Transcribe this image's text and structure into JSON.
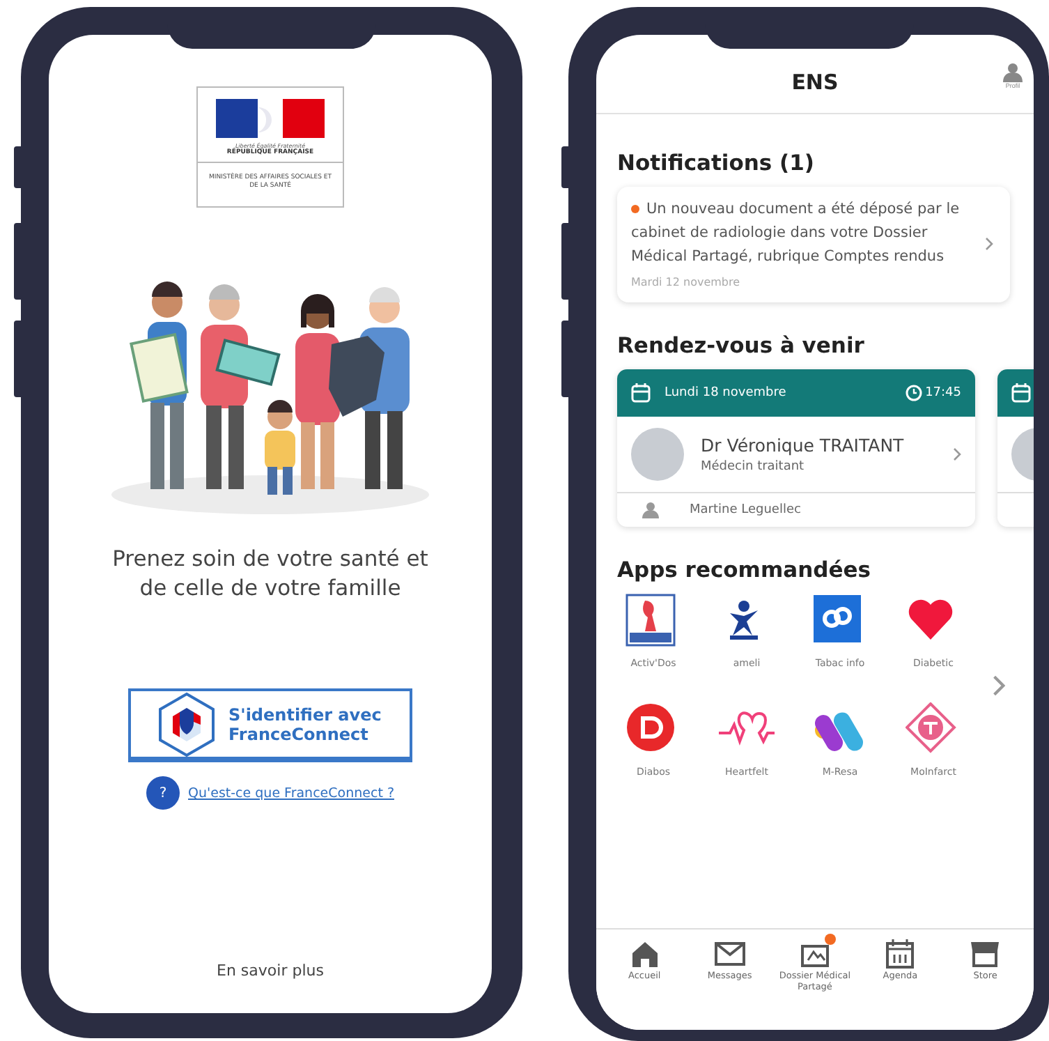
{
  "left_screen": {
    "logo": {
      "motto": "Liberté Égalité Fraternité",
      "republic": "RÉPUBLIQUE FRANÇAISE",
      "ministry": "MINISTÈRE DES AFFAIRES SOCIALES ET DE LA SANTÉ"
    },
    "tagline": "Prenez soin de votre santé et de celle de votre famille",
    "login_button": {
      "line1": "S'identifier avec",
      "line2": "FranceConnect"
    },
    "help": {
      "icon": "?",
      "link": "Qu'est-ce que FranceConnect ?"
    },
    "footer_link": "En savoir plus"
  },
  "right_screen": {
    "header": {
      "title": "ENS",
      "profile_label": "Profil"
    },
    "notifications": {
      "title": "Notifications (1)",
      "items": [
        {
          "unread": true,
          "text": "Un nouveau document a été déposé par le cabinet de radiologie dans votre Dossier Médical Partagé, rubrique Comptes rendus",
          "date": "Mardi 12 novembre"
        }
      ]
    },
    "appointments": {
      "title": "Rendez-vous à venir",
      "items": [
        {
          "date": "Lundi 18 novembre",
          "time": "17:45",
          "doctor": "Dr Véronique TRAITANT",
          "specialty": "Médecin traitant",
          "patient": "Martine Leguellec"
        }
      ]
    },
    "apps": {
      "title": "Apps recommandées",
      "items": [
        {
          "label": "Activ'Dos"
        },
        {
          "label": "ameli"
        },
        {
          "label": "Tabac info"
        },
        {
          "label": "Diabetic"
        },
        {
          "label": "Diabos"
        },
        {
          "label": "Heartfelt"
        },
        {
          "label": "M-Resa"
        },
        {
          "label": "MoInfarct"
        }
      ]
    },
    "nav": [
      {
        "label": "Accueil",
        "badge": false
      },
      {
        "label": "Messages",
        "badge": false
      },
      {
        "label": "Dossier Médical Partagé",
        "badge": true
      },
      {
        "label": "Agenda",
        "badge": false
      },
      {
        "label": "Store",
        "badge": false
      }
    ]
  }
}
